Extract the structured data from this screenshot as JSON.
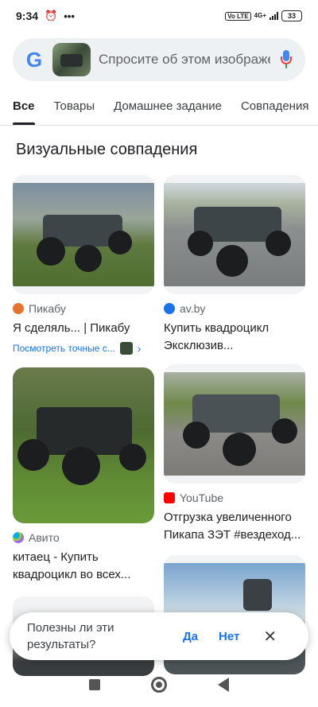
{
  "status": {
    "time": "9:34",
    "net_badge": "Vo LTE",
    "net_type": "4G+",
    "battery": "33"
  },
  "search": {
    "placeholder": "Спросите об этом изображении"
  },
  "tabs": [
    {
      "label": "Все"
    },
    {
      "label": "Товары"
    },
    {
      "label": "Домашнее задание"
    },
    {
      "label": "Совпадения"
    }
  ],
  "section_title": "Визуальные совпадения",
  "results": [
    {
      "source": "Пикабу",
      "title": "Я сделяль... | Пикабу",
      "exact_link": "Посмотреть точные с..."
    },
    {
      "source": "av.by",
      "title": "Купить квадроцикл Эксклюзив..."
    },
    {
      "source": "Авито",
      "title": "китаец - Купить квадроцикл во всех..."
    },
    {
      "source": "YouTube",
      "title": "Отгрузка увеличенного Пикапа ЗЭТ #вездеход..."
    }
  ],
  "feedback": {
    "question": "Полезны ли эти результаты?",
    "yes": "Да",
    "no": "Нет"
  },
  "colors": {
    "accent": "#1a73e8",
    "pikabu": "#e8732f",
    "avby": "#1a73e8",
    "youtube": "#ff0000"
  }
}
